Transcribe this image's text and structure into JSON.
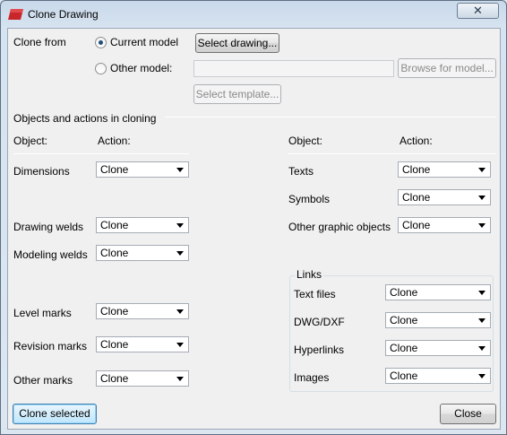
{
  "window": {
    "title": "Clone Drawing",
    "close_glyph": "✕"
  },
  "clone_from": {
    "label": "Clone from",
    "current_model": {
      "label": "Current model",
      "selected": true
    },
    "other_model": {
      "label": "Other model:",
      "selected": false,
      "value": ""
    },
    "select_drawing_label": "Select drawing...",
    "browse_for_model_label": "Browse for model...",
    "select_template_label": "Select template..."
  },
  "section_title": "Objects and actions in cloning",
  "left_headers": {
    "object": "Object:",
    "action": "Action:"
  },
  "right_headers": {
    "object": "Object:",
    "action": "Action:"
  },
  "left_rows": [
    {
      "label": "Dimensions",
      "value": "Clone"
    },
    {
      "label": "Drawing welds",
      "value": "Clone"
    },
    {
      "label": "Modeling welds",
      "value": "Clone"
    },
    {
      "label": "Level marks",
      "value": "Clone"
    },
    {
      "label": "Revision marks",
      "value": "Clone"
    },
    {
      "label": "Other marks",
      "value": "Clone"
    }
  ],
  "right_rows": [
    {
      "label": "Texts",
      "value": "Clone"
    },
    {
      "label": "Symbols",
      "value": "Clone"
    },
    {
      "label": "Other graphic objects",
      "value": "Clone"
    }
  ],
  "links": {
    "title": "Links",
    "rows": [
      {
        "label": "Text files",
        "value": "Clone"
      },
      {
        "label": "DWG/DXF",
        "value": "Clone"
      },
      {
        "label": "Hyperlinks",
        "value": "Clone"
      },
      {
        "label": "Images",
        "value": "Clone"
      }
    ]
  },
  "footer": {
    "clone_selected_label": "Clone selected",
    "close_label": "Close"
  },
  "colors": {
    "titlebar": "#c9d9ea",
    "client": "#f0f0f0",
    "icon_red": "#c8262a"
  }
}
